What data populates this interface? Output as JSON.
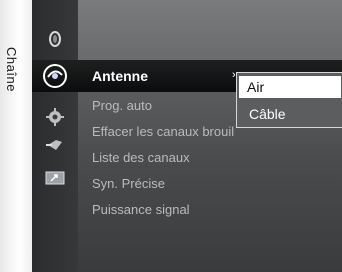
{
  "side_tab": {
    "label": "Chaîne"
  },
  "icons": [
    {
      "name": "picture-icon",
      "selected": false
    },
    {
      "name": "satellite-dish-icon",
      "selected": true
    },
    {
      "name": "gear-icon",
      "selected": false
    },
    {
      "name": "input-plug-icon",
      "selected": false
    },
    {
      "name": "screen-arrow-icon",
      "selected": false
    }
  ],
  "menu": {
    "items": [
      {
        "label": "Antenne",
        "selected": true
      },
      {
        "label": "Prog. auto"
      },
      {
        "label": "Effacer les canaux brouillés"
      },
      {
        "label": "Liste des canaux"
      },
      {
        "label": "Syn. Précise"
      },
      {
        "label": "Puissance signal"
      }
    ]
  },
  "dropdown": {
    "options": [
      "Air",
      "Câble"
    ],
    "selected": "Air"
  },
  "colors": {
    "highlight": "#ffffff",
    "menu_text": "#b9bbbd",
    "selected_row": "#0c0c0c"
  }
}
